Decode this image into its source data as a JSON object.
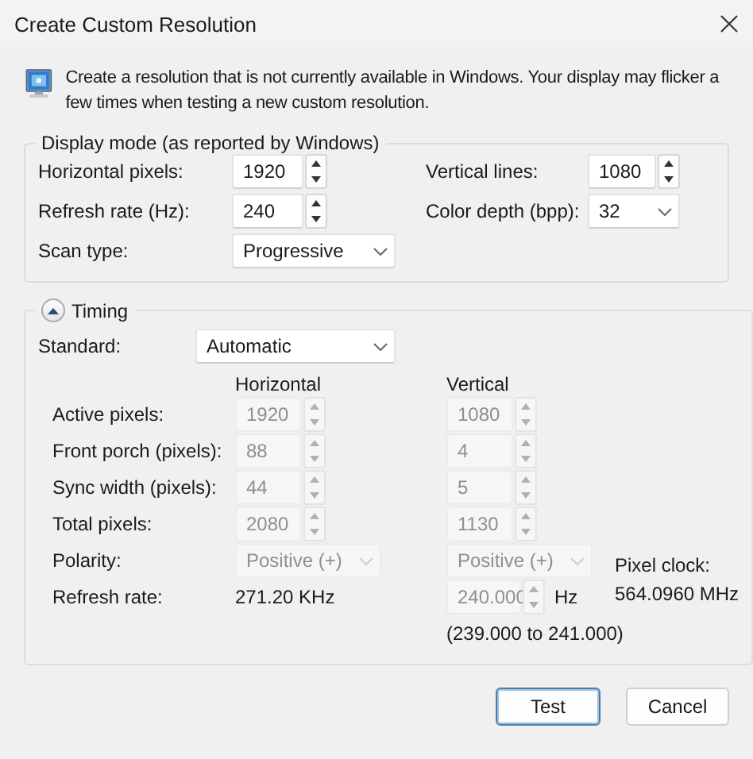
{
  "window": {
    "title": "Create Custom Resolution"
  },
  "intro": "Create a resolution that is not currently available in Windows. Your display may flicker a few times when testing a new custom resolution.",
  "display_mode": {
    "title": "Display mode (as reported by Windows)",
    "rows": [
      {
        "left": {
          "label": "Horizontal pixels:",
          "kind": "spin",
          "value": "1920",
          "disabled": false
        },
        "right": {
          "label": "Vertical lines:",
          "kind": "spin",
          "value": "1080",
          "disabled": false
        }
      },
      {
        "left": {
          "label": "Refresh rate (Hz):",
          "kind": "spin",
          "value": "240",
          "disabled": false
        },
        "right": {
          "label": "Color depth (bpp):",
          "kind": "combo",
          "value": "32",
          "disabled": false
        }
      },
      {
        "left": {
          "label": "Scan type:",
          "kind": "combo",
          "value": "Progressive",
          "disabled": false
        }
      }
    ]
  },
  "timing": {
    "title": "Timing",
    "expanded": true,
    "standard": {
      "label": "Standard:",
      "value": "Automatic",
      "disabled": false
    },
    "columns": [
      "Horizontal",
      "Vertical"
    ],
    "rows": [
      {
        "label": "Active pixels:",
        "horizontal": {
          "kind": "spin",
          "value": "1920",
          "disabled": true
        },
        "vertical": {
          "kind": "spin",
          "value": "1080",
          "disabled": true
        }
      },
      {
        "label": "Front porch (pixels):",
        "horizontal": {
          "kind": "spin",
          "value": "88",
          "disabled": true
        },
        "vertical": {
          "kind": "spin",
          "value": "4",
          "disabled": true
        }
      },
      {
        "label": "Sync width (pixels):",
        "horizontal": {
          "kind": "spin",
          "value": "44",
          "disabled": true
        },
        "vertical": {
          "kind": "spin",
          "value": "5",
          "disabled": true
        }
      },
      {
        "label": "Total pixels:",
        "horizontal": {
          "kind": "spin",
          "value": "2080",
          "disabled": true
        },
        "vertical": {
          "kind": "spin",
          "value": "1130",
          "disabled": true
        }
      },
      {
        "label": "Polarity:",
        "horizontal": {
          "kind": "combo",
          "value": "Positive (+)",
          "disabled": true
        },
        "vertical": {
          "kind": "combo",
          "value": "Positive (+)",
          "disabled": true
        }
      }
    ],
    "refresh_rate": {
      "label": "Refresh rate:",
      "horizontal": "271.20 KHz",
      "vertical": {
        "kind": "spin",
        "value": "240.000",
        "disabled": true
      },
      "unit": "Hz",
      "range": "(239.000 to 241.000)"
    },
    "pixel_clock": {
      "label": "Pixel clock:",
      "value": "564.0960 MHz"
    }
  },
  "buttons": [
    {
      "label": "Test",
      "default": true
    },
    {
      "label": "Cancel",
      "default": false
    }
  ]
}
